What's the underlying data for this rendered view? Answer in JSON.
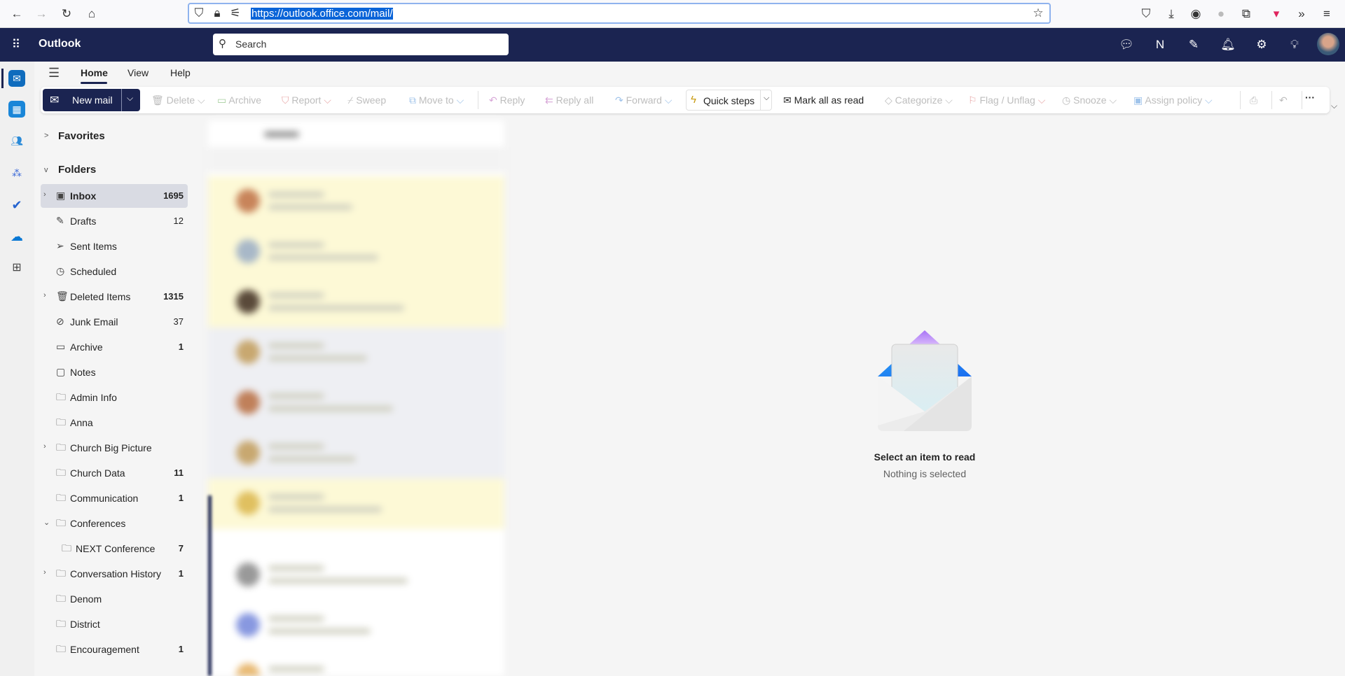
{
  "browser": {
    "url": "https://outlook.office.com/mail/",
    "icons": [
      "back-icon",
      "forward-icon",
      "reload-icon",
      "home-icon",
      "shield-icon",
      "lock-icon",
      "permissions-icon",
      "star-icon",
      "pocket-icon",
      "download-icon",
      "account-icon",
      "extension-icon",
      "puzzle-icon",
      "extension-badge-icon",
      "overflow-icon",
      "menu-icon"
    ]
  },
  "header": {
    "app_name": "Outlook",
    "search_placeholder": "Search",
    "bg": "#1b2451"
  },
  "ribbon": {
    "tabs": [
      "Home",
      "View",
      "Help"
    ],
    "active": "Home"
  },
  "toolbar": {
    "new_mail": "New mail",
    "delete": "Delete",
    "archive": "Archive",
    "report": "Report",
    "sweep": "Sweep",
    "move_to": "Move to",
    "reply": "Reply",
    "reply_all": "Reply all",
    "forward": "Forward",
    "quick_steps": "Quick steps",
    "mark_all_read": "Mark all as read",
    "categorize": "Categorize",
    "flag": "Flag / Unflag",
    "snooze": "Snooze",
    "assign_policy": "Assign policy"
  },
  "folders": {
    "favorites": "Favorites",
    "folders": "Folders",
    "items": [
      {
        "label": "Inbox",
        "count": "1695",
        "bold": true,
        "chev": ">",
        "icon": "inbox",
        "selected": true
      },
      {
        "label": "Drafts",
        "count": "12",
        "icon": "drafts"
      },
      {
        "label": "Sent Items",
        "count": "",
        "icon": "sent"
      },
      {
        "label": "Scheduled",
        "count": "",
        "icon": "clock"
      },
      {
        "label": "Deleted Items",
        "count": "1315",
        "bold": true,
        "chev": ">",
        "icon": "trash"
      },
      {
        "label": "Junk Email",
        "count": "37",
        "icon": "junk"
      },
      {
        "label": "Archive",
        "count": "1",
        "bold": true,
        "icon": "archive"
      },
      {
        "label": "Notes",
        "count": "",
        "icon": "note"
      },
      {
        "label": "Admin Info",
        "count": "",
        "icon": "folder"
      },
      {
        "label": "Anna",
        "count": "",
        "icon": "folder"
      },
      {
        "label": "Church Big Picture",
        "count": "",
        "chev": ">",
        "icon": "folder"
      },
      {
        "label": "Church Data",
        "count": "11",
        "bold": true,
        "icon": "folder"
      },
      {
        "label": "Communication",
        "count": "1",
        "bold": true,
        "icon": "folder"
      },
      {
        "label": "Conferences",
        "count": "",
        "chev": "v",
        "icon": "folder"
      },
      {
        "label": "NEXT Conference",
        "count": "7",
        "bold": true,
        "icon": "folder",
        "indent": true
      },
      {
        "label": "Conversation History",
        "count": "1",
        "bold": true,
        "chev": ">",
        "icon": "folder"
      },
      {
        "label": "Denom",
        "count": "",
        "icon": "folder"
      },
      {
        "label": "District",
        "count": "",
        "icon": "folder"
      },
      {
        "label": "Encouragement",
        "count": "1",
        "bold": true,
        "icon": "folder"
      }
    ]
  },
  "reading": {
    "title": "Select an item to read",
    "subtitle": "Nothing is selected"
  }
}
